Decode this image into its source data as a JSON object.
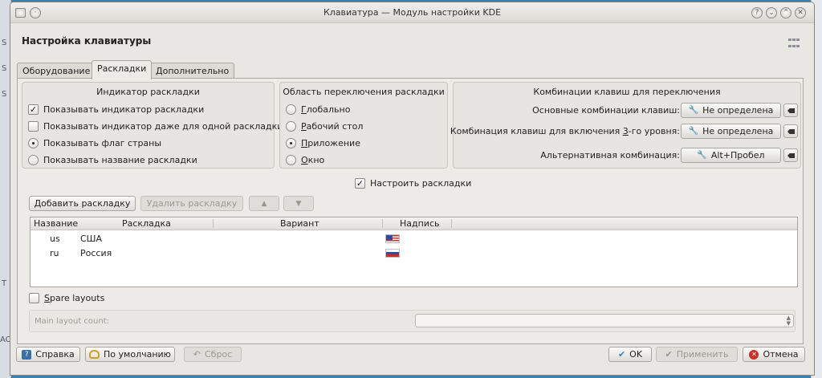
{
  "window": {
    "title": "Клавиатура — Модуль настройки KDE",
    "heading": "Настройка клавиатуры"
  },
  "background": {
    "left_fragments": [
      "S",
      "S",
      "S",
      "T",
      "AC"
    ]
  },
  "tabs": [
    {
      "label": "Оборудование",
      "active": false
    },
    {
      "label": "Раскладки",
      "active": true
    },
    {
      "label": "Дополнительно",
      "active": false
    }
  ],
  "indicator": {
    "title": "Индикатор раскладки",
    "options": [
      {
        "label": "Показывать индикатор раскладки",
        "type": "checkbox",
        "checked": true
      },
      {
        "label": "Показывать индикатор даже для одной раскладки",
        "type": "checkbox",
        "checked": false
      },
      {
        "label": "Показывать флаг страны",
        "type": "radio",
        "checked": true
      },
      {
        "label": "Показывать название раскладки",
        "type": "radio",
        "checked": false
      }
    ]
  },
  "switching": {
    "title": "Область переключения раскладки",
    "options": [
      {
        "label": "Глобально",
        "checked": false
      },
      {
        "label": "Рабочий стол",
        "checked": false
      },
      {
        "label": "Приложение",
        "checked": true
      },
      {
        "label": "Окно",
        "checked": false
      }
    ]
  },
  "shortcuts": {
    "title": "Комбинации клавиш для переключения",
    "rows": [
      {
        "label": "Основные комбинации клавиш:",
        "value": "Не определена"
      },
      {
        "label": "Комбинация клавиш для включения 3-го уровня:",
        "value": "Не определена"
      },
      {
        "label": "Альтернативная комбинация:",
        "value": "Alt+Пробел"
      }
    ]
  },
  "configure_layouts": {
    "label": "Настроить раскладки",
    "checked": true
  },
  "layout_buttons": {
    "add": "Добавить раскладку",
    "remove": "Удалить раскладку"
  },
  "table": {
    "columns": [
      "Название",
      "Раскладка",
      "Вариант",
      "Надпись"
    ],
    "rows": [
      {
        "name": "us",
        "layout": "США",
        "variant": "",
        "flag": "us"
      },
      {
        "name": "ru",
        "layout": "Россия",
        "variant": "",
        "flag": "ru"
      }
    ]
  },
  "spare": {
    "label": "Spare layouts",
    "checked": false,
    "count_label": "Main layout count:"
  },
  "footer": {
    "help": "Справка",
    "defaults": "По умолчанию",
    "reset": "Сброс",
    "ok": "OK",
    "apply": "Применить",
    "cancel": "Отмена"
  },
  "colors": {
    "desktop": "#3c7fb1",
    "window_bg": "#e9e7e3",
    "cancel_red": "#c8322a",
    "ok_check": "#3a7fc4"
  }
}
